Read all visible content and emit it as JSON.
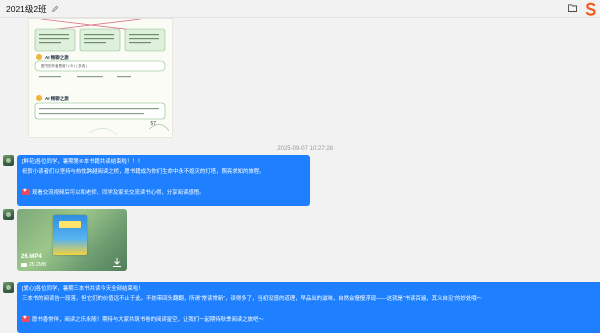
{
  "window": {
    "title": "2021级2班"
  },
  "icons": {
    "edit": "edit-icon",
    "folder": "folder-icon",
    "brand": "brand-logo-icon",
    "download": "download-icon",
    "video": "video-icon"
  },
  "shared_image": {
    "page_number": "57",
    "section_1": "AI 畅聊之旅",
    "section_1_text": "图书的作者是谁? ( B ) ( 多选 )",
    "section_1_options": "A. 小兰老师    B. 小贝壳老师    C. 大树",
    "section_2": "AI 畅聊之旅",
    "section_2_text": "跟读推荐作文后,在学习中感受到了写作乐趣。"
  },
  "timestamp": "2025-09-07 10:27:28",
  "messages": [
    {
      "lines": [
        "[鲜花]各位同学，暑期第⑥本书籍共读结束啦！！！",
        "祝贺小读者们以坚持与热忱跨越阅读之桥，愿书籍成为你们生命中永不熄灭的灯塔，照亮求知的旅程。",
        "",
        "观看交流视频后可以和老师、同学及家长交流读书心得，分享阅读感悟。"
      ]
    },
    {
      "lines": [
        "[爱心]各位同学，暑期三本书共读今天全部结束啦！",
        "三本书的阅读告一段落，但它们的价值远不止于此。不妨带回头翻翻，所谓“常读常新”，读得多了，当初没感的道理，早品出的滋味，自然会慢慢浮现——这就是“书读百遍，其义自见”的妙处哦～",
        "",
        "愿书香常伴，阅读之乐永随！期待与大家共筑书卷的阅读星空，让我们一起期待秋季阅读之旅吧～"
      ]
    }
  ],
  "video": {
    "name": "26.MP4",
    "size": "25.2MB"
  },
  "colors": {
    "bubble": "#1e80ff",
    "background": "#f2f2f2",
    "brand": "#f05a1e"
  }
}
